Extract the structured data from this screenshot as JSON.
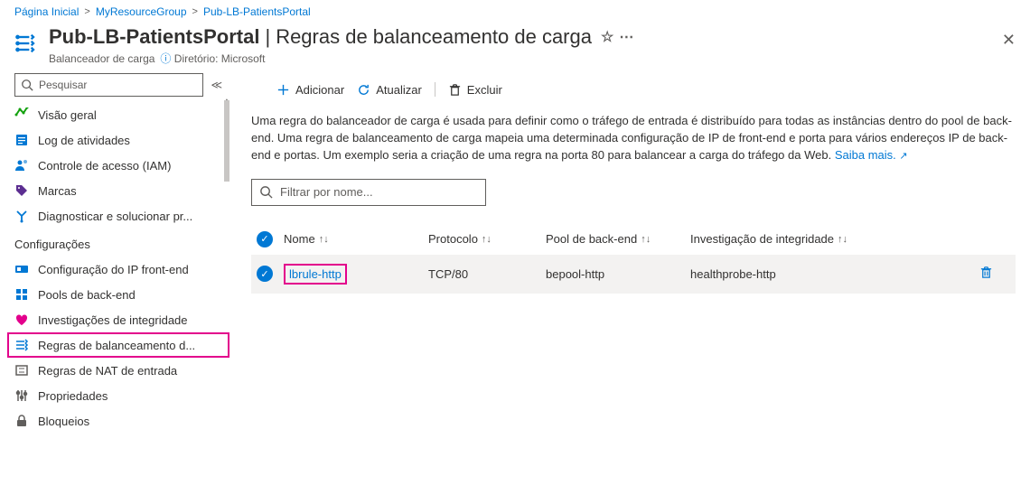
{
  "breadcrumb": {
    "home": "Página Inicial",
    "group": "MyResourceGroup",
    "resource": "Pub-LB-PatientsPortal"
  },
  "header": {
    "title_strong": "Pub-LB-PatientsPortal",
    "title_light": "Regras de balanceamento de carga",
    "subtitle_type": "Balanceador de carga",
    "directory_label": "Diretório: Microsoft"
  },
  "sidebar": {
    "search_placeholder": "Pesquisar",
    "items_top": [
      "Visão geral",
      "Log de atividades",
      "Controle de acesso (IAM)",
      "Marcas",
      "Diagnosticar e solucionar pr..."
    ],
    "section_settings": "Configurações",
    "items_settings": [
      "Configuração do IP front-end",
      "Pools de back-end",
      "Investigações de integridade",
      "Regras de balanceamento d...",
      "Regras de NAT de entrada",
      "Propriedades",
      "Bloqueios"
    ]
  },
  "toolbar": {
    "add": "Adicionar",
    "refresh": "Atualizar",
    "delete": "Excluir"
  },
  "description": {
    "text": "Uma regra do balanceador de carga é usada para definir como o tráfego de entrada é distribuído para todas as instâncias dentro do pool de back-end. Uma regra de balanceamento de carga mapeia uma determinada configuração de IP de front-end e porta para vários endereços IP de back-end e portas. Um exemplo seria a criação de uma regra na porta 80 para balancear a carga do tráfego da Web.",
    "learn_more": "Saiba mais."
  },
  "filter": {
    "placeholder": "Filtrar por nome..."
  },
  "columns": {
    "name": "Nome",
    "protocol": "Protocolo",
    "backend": "Pool de back-end",
    "probe": "Investigação de integridade"
  },
  "rows": [
    {
      "name": "lbrule-http",
      "protocol": "TCP/80",
      "backend": "bepool-http",
      "probe": "healthprobe-http"
    }
  ]
}
